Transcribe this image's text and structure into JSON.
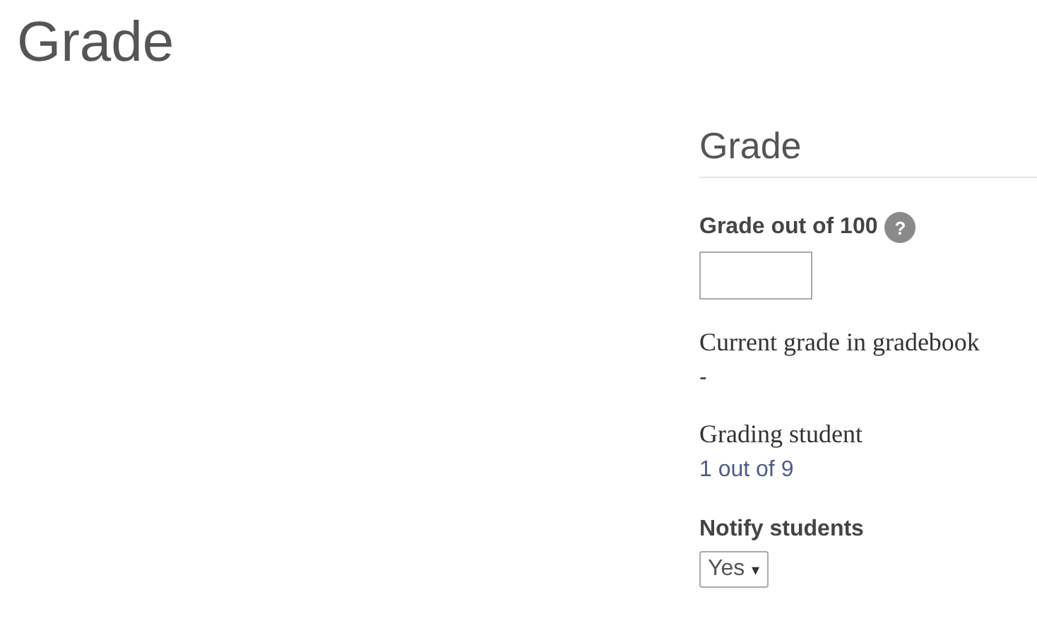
{
  "page_title": "Grade",
  "section": {
    "title": "Grade",
    "grade_field": {
      "label": "Grade out of 100",
      "help": "?"
    },
    "current_grade": {
      "label": "Current grade in gradebook",
      "value": "-"
    },
    "grading_student": {
      "label": "Grading student",
      "value": "1 out of 9"
    },
    "notify": {
      "label": "Notify students",
      "value": "Yes",
      "caret": "▾"
    }
  }
}
